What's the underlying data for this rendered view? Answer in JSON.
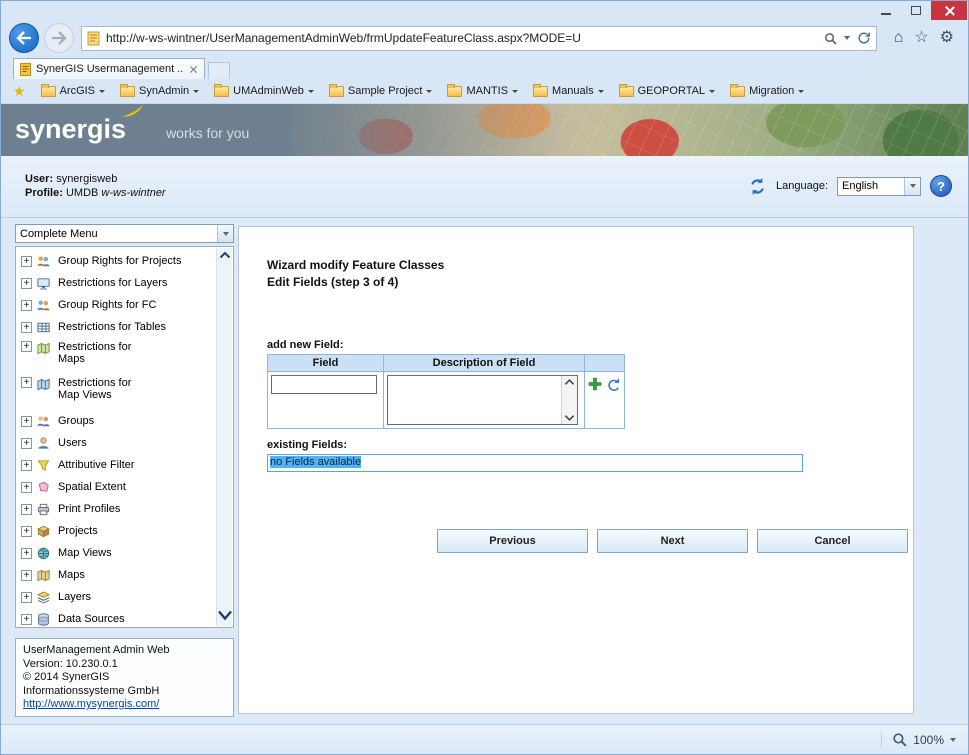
{
  "icons": {
    "home": "⌂",
    "favorites": "☆",
    "settings": "⚙",
    "favorites_star": "★",
    "help": "?",
    "expand": "+"
  },
  "browser": {
    "url": "http://w-ws-wintner/UserManagementAdminWeb/frmUpdateFeatureClass.aspx?MODE=U",
    "tab_title": "SynerGIS Usermanagement ...",
    "zoom_level": "100%",
    "favorites": [
      "ArcGIS",
      "SynAdmin",
      "UMAdminWeb",
      "Sample Project",
      "MANTIS",
      "Manuals",
      "GEOPORTAL",
      "Migration"
    ]
  },
  "banner": {
    "logo": "synergis",
    "tagline": "works for you"
  },
  "userbar": {
    "user_label": "User:",
    "user_value": "synergisweb",
    "profile_label": "Profile:",
    "profile_db": "UMDB",
    "profile_host": "w-ws-wintner",
    "language_label": "Language:",
    "language_value": "English"
  },
  "sidebar": {
    "menu_select": "Complete Menu",
    "items": [
      {
        "label": "Group Rights for Projects"
      },
      {
        "label": "Restrictions for Layers"
      },
      {
        "label": "Group Rights for FC"
      },
      {
        "label": "Restrictions for Tables"
      },
      {
        "label": "Restrictions for Maps"
      },
      {
        "label": "Restrictions for Map Views"
      },
      {
        "label": "Groups"
      },
      {
        "label": "Users"
      },
      {
        "label": "Attributive Filter"
      },
      {
        "label": "Spatial Extent"
      },
      {
        "label": "Print Profiles"
      },
      {
        "label": "Projects"
      },
      {
        "label": "Map Views"
      },
      {
        "label": "Maps"
      },
      {
        "label": "Layers"
      },
      {
        "label": "Data Sources"
      }
    ],
    "footer": {
      "app": "UserManagement Admin Web",
      "version": "Version: 10.230.0.1",
      "copyright": "© 2014 SynerGIS",
      "company": "Informationssysteme GmbH",
      "link": "http://www.mysynergis.com/"
    }
  },
  "main": {
    "title_line1": "Wizard modify Feature Classes",
    "title_line2": "Edit Fields (step 3 of 4)",
    "add_new_field_label": "add new Field:",
    "table": {
      "col_field": "Field",
      "col_description": "Description of Field"
    },
    "existing_fields_label": "existing Fields:",
    "existing_fields_value": "no Fields available",
    "buttons": {
      "previous": "Previous",
      "next": "Next",
      "cancel": "Cancel"
    }
  },
  "colors": {
    "accent": "#1d6fc0",
    "selection": "#52b2f2",
    "close_button": "#c9353f",
    "swoosh": "#eec800"
  }
}
